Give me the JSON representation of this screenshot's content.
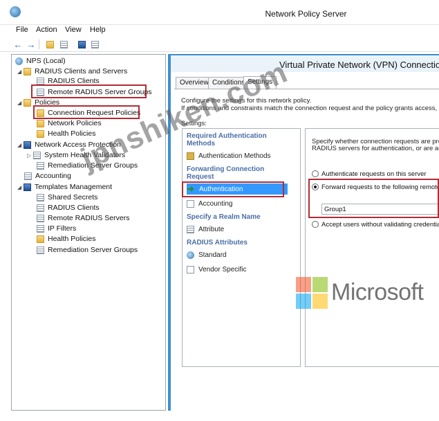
{
  "window": {
    "title": "Network Policy Server"
  },
  "menu": {
    "file": "File",
    "action": "Action",
    "view": "View",
    "help": "Help"
  },
  "tree": {
    "root": "NPS (Local)",
    "radius_clients_servers": "RADIUS Clients and Servers",
    "radius_clients": "RADIUS Clients",
    "remote_radius_groups": "Remote RADIUS Server Groups",
    "policies": "Policies",
    "connection_request_policies": "Connection Request Policies",
    "network_policies": "Network Policies",
    "health_policies": "Health Policies",
    "nap": "Network Access Protection",
    "system_health_validators": "System Health Validators",
    "remediation_server_groups": "Remediation Server Groups",
    "accounting": "Accounting",
    "templates_management": "Templates Management",
    "shared_secrets": "Shared Secrets",
    "t_radius_clients": "RADIUS Clients",
    "t_remote_radius_servers": "Remote RADIUS Servers",
    "ip_filters": "IP Filters",
    "t_health_policies": "Health Policies",
    "t_remediation_server_groups": "Remediation Server Groups"
  },
  "dialog": {
    "title": "Virtual Private Network (VPN) Connectio",
    "tabs": {
      "overview": "Overview",
      "conditions": "Conditions",
      "settings": "Settings"
    },
    "desc_line1": "Configure the settings for this network policy.",
    "desc_line2": "If conditions and constraints match the connection request and the policy grants access, se",
    "settings_label": "Settings:",
    "list": {
      "cat_required_auth": "Required Authentication Methods",
      "auth_methods": "Authentication Methods",
      "cat_forwarding": "Forwarding Connection Request",
      "authentication": "Authentication",
      "accounting": "Accounting",
      "cat_realm": "Specify a Realm Name",
      "attribute": "Attribute",
      "cat_radius_attrs": "RADIUS Attributes",
      "standard": "Standard",
      "vendor_specific": "Vendor Specific"
    },
    "right": {
      "text1": "Specify whether connection requests are pro",
      "text2": "RADIUS servers for authentication, or are ac",
      "opt_local": "Authenticate requests on this server",
      "opt_forward": "Forward requests to the following remote",
      "group_value": "Group1",
      "opt_accept": "Accept users without validating credentia"
    }
  },
  "overlay": {
    "watermark": "jpnshiken.com",
    "ms_text": "Microsoft",
    "ms_colors": [
      "#f25022",
      "#7fba00",
      "#00a4ef",
      "#ffb900"
    ]
  }
}
